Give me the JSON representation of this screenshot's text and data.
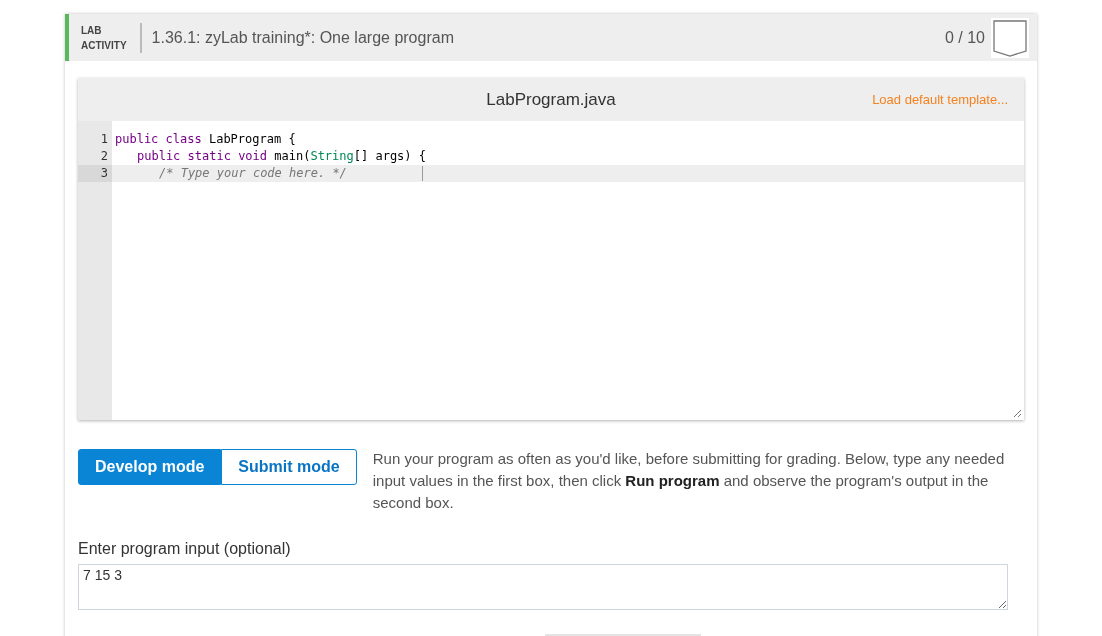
{
  "header": {
    "kind_label": [
      "LAB",
      "ACTIVITY"
    ],
    "title": "1.36.1: zyLab training*: One large program",
    "score": "0 / 10"
  },
  "editor": {
    "filename": "LabProgram.java",
    "template_link": "Load default template...",
    "lines": [
      {
        "number": "1",
        "active": false,
        "tokens": [
          {
            "kind": "keyword",
            "text": "public class"
          },
          {
            "kind": "plain",
            "text": " LabProgram {"
          }
        ],
        "children": [
          {
            "number": "2",
            "active": false,
            "tokens": [
              {
                "kind": "keyword",
                "text": "public static void"
              },
              {
                "kind": "plain",
                "text": " main("
              },
              {
                "kind": "type",
                "text": "String"
              },
              {
                "kind": "plain",
                "text": "[] args) {"
              }
            ],
            "children": [
              {
                "number": "3",
                "active": true,
                "tokens": [
                  {
                    "kind": "comment",
                    "text": "/* Type your code here. */"
                  }
                ]
              }
            ]
          }
        ]
      }
    ]
  },
  "modes": [
    {
      "label": "Develop mode",
      "selected": true
    },
    {
      "label": "Submit mode",
      "selected": false
    }
  ],
  "instructions": "Run your program as often as you'd like, before submitting for grading. Below, type any needed input values in the first box, then click **Run program** and observe the program's output in the second box.",
  "input": {
    "label": "Enter program input (optional)",
    "value": "7 15 3"
  }
}
